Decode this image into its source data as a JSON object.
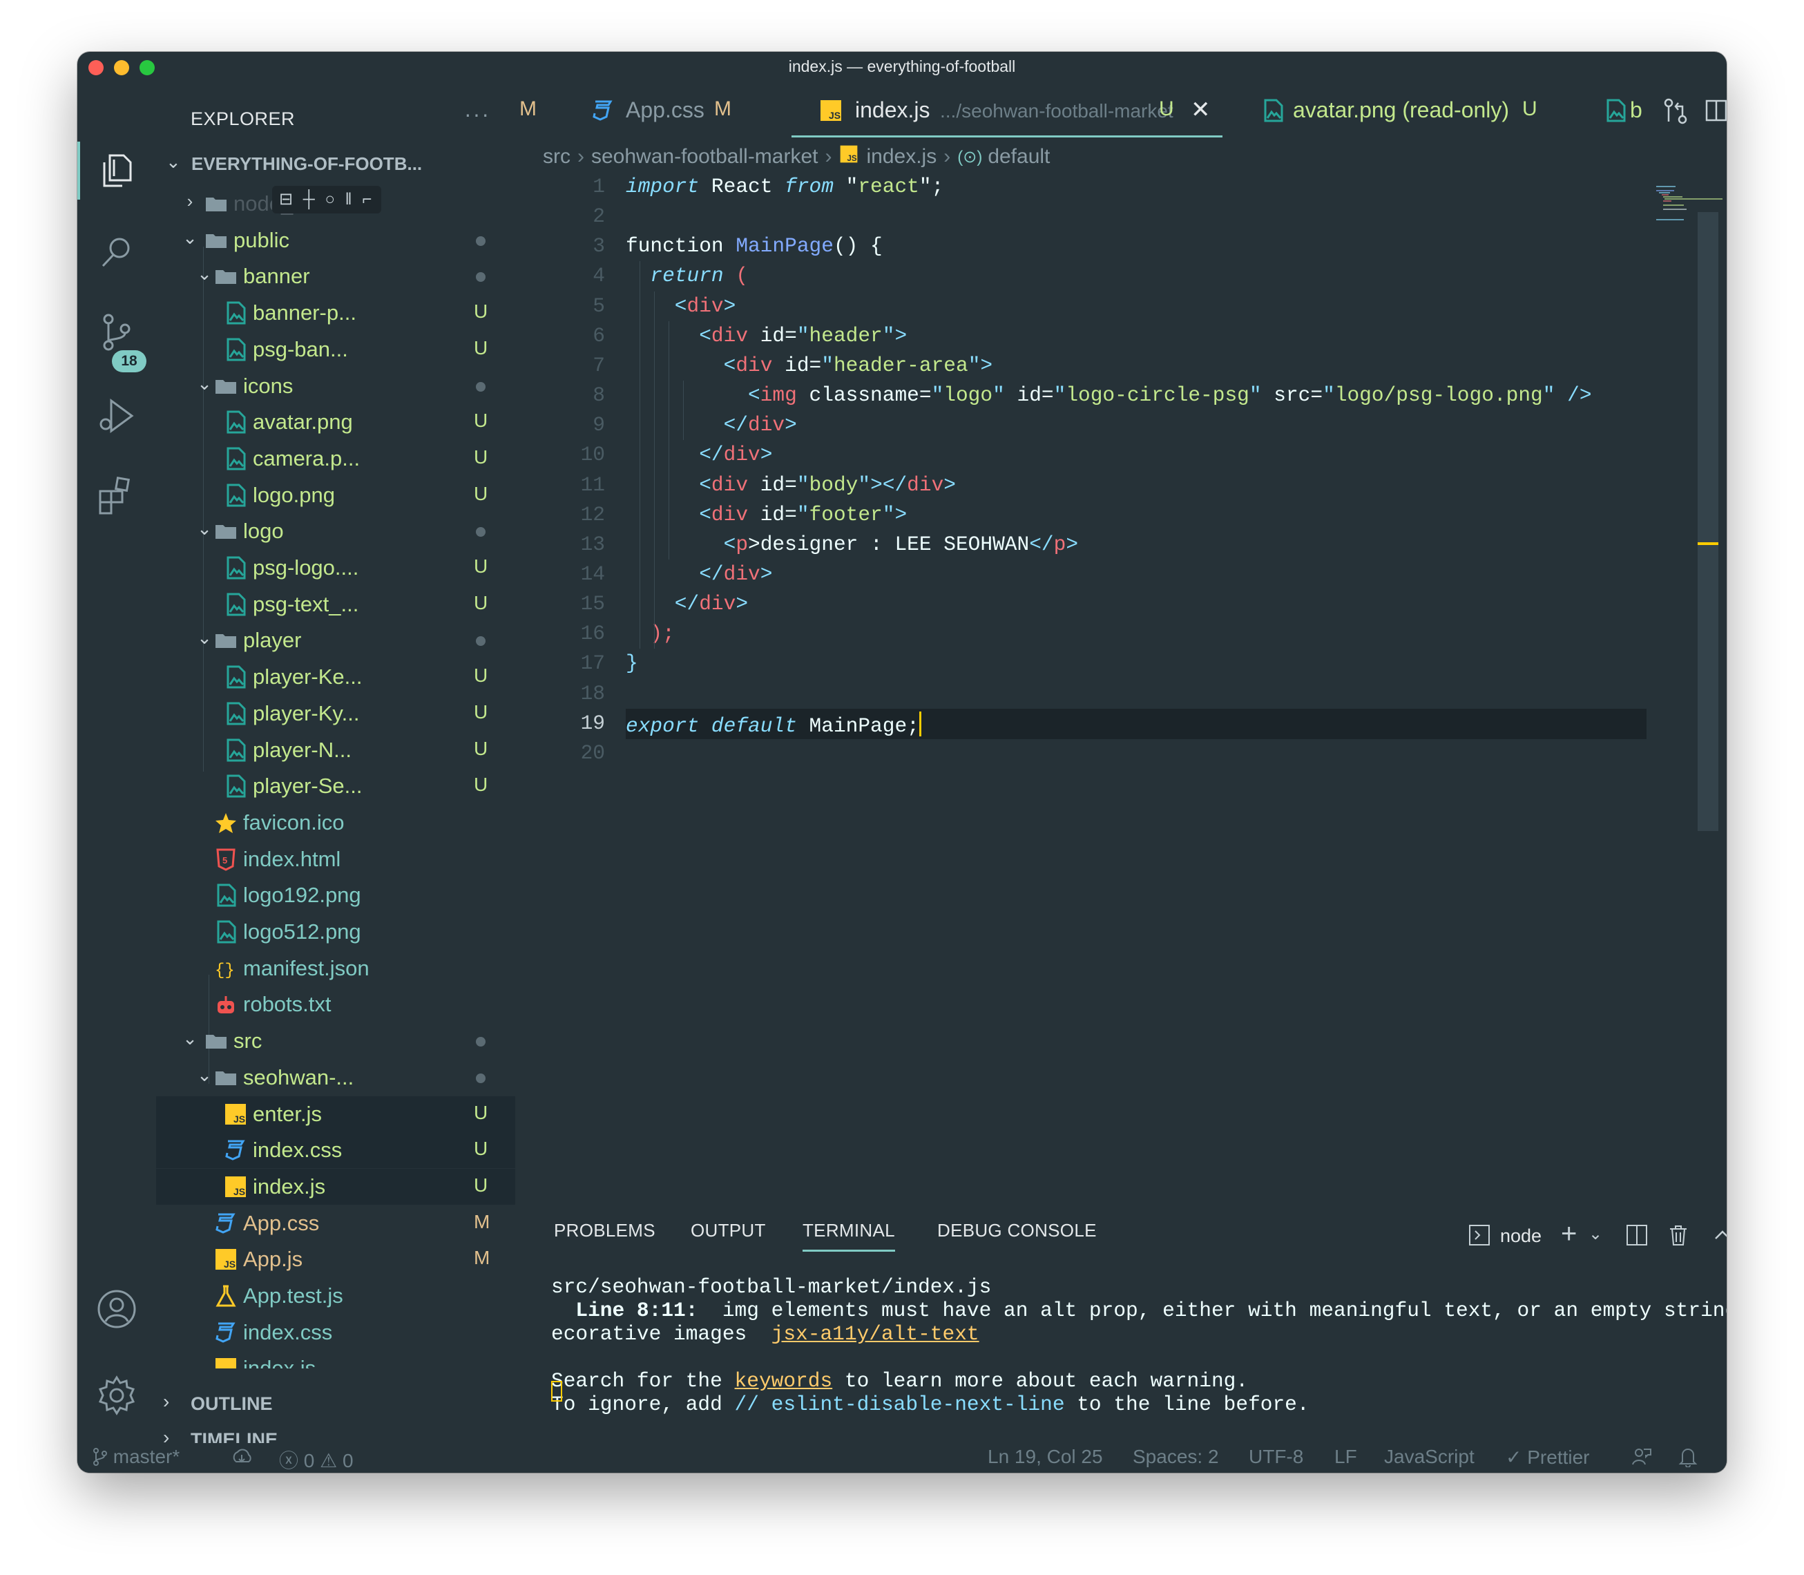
{
  "window": {
    "title": "index.js — everything-of-football"
  },
  "colors": {
    "bg": "#263238",
    "accent": "#80cbc4",
    "fg": "#eeffff",
    "folder": "#90a4ae",
    "git_untracked": "#c3e88d",
    "git_modified": "#e2c08d",
    "js_yellow": "#ffca28",
    "keyword_italic": "#89ddff",
    "string": "#c3e88d",
    "tag": "#f07178",
    "func": "#82aaff",
    "cursor": "#ffcc00"
  },
  "activity_bar": {
    "items": [
      {
        "name": "explorer-icon"
      },
      {
        "name": "search-icon"
      },
      {
        "name": "source-control-icon",
        "badge": "18"
      },
      {
        "name": "run-debug-icon"
      },
      {
        "name": "extensions-icon"
      }
    ],
    "bottom": [
      {
        "name": "account-icon"
      },
      {
        "name": "settings-gear-icon"
      }
    ]
  },
  "explorer": {
    "title": "EXPLORER",
    "more": "···",
    "root": "EVERYTHING-OF-FOOTB...",
    "rows": [
      {
        "label": "node_modules",
        "depth": 1,
        "kind": "folder-closed",
        "color": "#4f5b62",
        "status": "",
        "tooltip": "⊟ ┼ ○ ‖ ⌐"
      },
      {
        "label": "public",
        "depth": 1,
        "kind": "folder-open",
        "color": "#c3e88d",
        "status": "dot"
      },
      {
        "label": "banner",
        "depth": 2,
        "kind": "folder-open",
        "color": "#c3e88d",
        "status": "dot"
      },
      {
        "label": "banner-p...",
        "depth": 3,
        "kind": "image",
        "color": "#c3e88d",
        "status": "U"
      },
      {
        "label": "psg-ban...",
        "depth": 3,
        "kind": "image",
        "color": "#c3e88d",
        "status": "U"
      },
      {
        "label": "icons",
        "depth": 2,
        "kind": "folder-open",
        "color": "#c3e88d",
        "status": "dot"
      },
      {
        "label": "avatar.png",
        "depth": 3,
        "kind": "image",
        "color": "#c3e88d",
        "status": "U"
      },
      {
        "label": "camera.p...",
        "depth": 3,
        "kind": "image",
        "color": "#c3e88d",
        "status": "U"
      },
      {
        "label": "logo.png",
        "depth": 3,
        "kind": "image",
        "color": "#c3e88d",
        "status": "U"
      },
      {
        "label": "logo",
        "depth": 2,
        "kind": "folder-open",
        "color": "#c3e88d",
        "status": "dot"
      },
      {
        "label": "psg-logo....",
        "depth": 3,
        "kind": "image",
        "color": "#c3e88d",
        "status": "U"
      },
      {
        "label": "psg-text_...",
        "depth": 3,
        "kind": "image",
        "color": "#c3e88d",
        "status": "U"
      },
      {
        "label": "player",
        "depth": 2,
        "kind": "folder-open",
        "color": "#c3e88d",
        "status": "dot"
      },
      {
        "label": "player-Ke...",
        "depth": 3,
        "kind": "image",
        "color": "#c3e88d",
        "status": "U"
      },
      {
        "label": "player-Ky...",
        "depth": 3,
        "kind": "image",
        "color": "#c3e88d",
        "status": "U"
      },
      {
        "label": "player-N...",
        "depth": 3,
        "kind": "image",
        "color": "#c3e88d",
        "status": "U"
      },
      {
        "label": "player-Se...",
        "depth": 3,
        "kind": "image",
        "color": "#c3e88d",
        "status": "U"
      },
      {
        "label": "favicon.ico",
        "depth": 2,
        "kind": "star",
        "color": "#80cbc4",
        "status": ""
      },
      {
        "label": "index.html",
        "depth": 2,
        "kind": "html",
        "color": "#80cbc4",
        "status": ""
      },
      {
        "label": "logo192.png",
        "depth": 2,
        "kind": "image",
        "color": "#80cbc4",
        "status": ""
      },
      {
        "label": "logo512.png",
        "depth": 2,
        "kind": "image",
        "color": "#80cbc4",
        "status": ""
      },
      {
        "label": "manifest.json",
        "depth": 2,
        "kind": "json",
        "color": "#80cbc4",
        "status": ""
      },
      {
        "label": "robots.txt",
        "depth": 2,
        "kind": "robot",
        "color": "#80cbc4",
        "status": ""
      },
      {
        "label": "src",
        "depth": 1,
        "kind": "folder-open",
        "color": "#c3e88d",
        "status": "dot"
      },
      {
        "label": "seohwan-...",
        "depth": 2,
        "kind": "folder-open",
        "color": "#c3e88d",
        "status": "dot"
      },
      {
        "label": "enter.js",
        "depth": 3,
        "kind": "js",
        "color": "#c3e88d",
        "status": "U",
        "selected": true
      },
      {
        "label": "index.css",
        "depth": 3,
        "kind": "css",
        "color": "#c3e88d",
        "status": "U",
        "selected": true
      },
      {
        "label": "index.js",
        "depth": 3,
        "kind": "js",
        "color": "#c3e88d",
        "status": "U",
        "selected": true
      },
      {
        "label": "App.css",
        "depth": 2,
        "kind": "css",
        "color": "#e2c08d",
        "status": "M"
      },
      {
        "label": "App.js",
        "depth": 2,
        "kind": "js",
        "color": "#e2c08d",
        "status": "M"
      },
      {
        "label": "App.test.js",
        "depth": 2,
        "kind": "test",
        "color": "#80cbc4",
        "status": ""
      },
      {
        "label": "index.css",
        "depth": 2,
        "kind": "css",
        "color": "#80cbc4",
        "status": ""
      },
      {
        "label": "index.js",
        "depth": 2,
        "kind": "js",
        "color": "#80cbc4",
        "status": "",
        "clipped": true
      }
    ],
    "outline": "OUTLINE",
    "timeline": "TIMELINE"
  },
  "tabs": [
    {
      "label": "",
      "status": "M",
      "icon": "none"
    },
    {
      "label": "App.css",
      "status": "M",
      "icon": "css"
    },
    {
      "label": "index.js",
      "desc": ".../seohwan-football-market",
      "status": "U",
      "icon": "js",
      "active": true
    },
    {
      "label": "avatar.png (read-only)",
      "status": "U",
      "icon": "image"
    },
    {
      "label": "b",
      "status": "",
      "icon": "image"
    }
  ],
  "tab_actions": [
    "open-changes-icon",
    "split-editor-icon",
    "more-actions-icon"
  ],
  "breadcrumbs": {
    "parts": [
      "src",
      "seohwan-football-market",
      "index.js",
      "default"
    ]
  },
  "code": {
    "current_line": 19,
    "lines": [
      [
        [
          "import",
          "kw"
        ],
        [
          " React ",
          "fg"
        ],
        [
          "from",
          "kw"
        ],
        [
          " \"",
          "fg"
        ],
        [
          "react",
          "str"
        ],
        [
          "\";",
          "fg"
        ]
      ],
      [],
      [
        [
          "function ",
          "fg"
        ],
        [
          "MainPage",
          "fn"
        ],
        [
          "() {",
          "fg"
        ]
      ],
      [
        [
          "  ",
          "fg"
        ],
        [
          "return",
          "kw"
        ],
        [
          " (",
          "tag"
        ]
      ],
      [
        [
          "    <",
          "pun"
        ],
        [
          "div",
          "tag"
        ],
        [
          ">",
          "pun"
        ]
      ],
      [
        [
          "      <",
          "pun"
        ],
        [
          "div",
          "tag"
        ],
        [
          " id=",
          "fg"
        ],
        [
          "\"",
          "pun"
        ],
        [
          "header",
          "str"
        ],
        [
          "\"",
          "pun"
        ],
        [
          ">",
          "pun"
        ]
      ],
      [
        [
          "        <",
          "pun"
        ],
        [
          "div",
          "tag"
        ],
        [
          " id=",
          "fg"
        ],
        [
          "\"",
          "pun"
        ],
        [
          "header-area",
          "str"
        ],
        [
          "\"",
          "pun"
        ],
        [
          ">",
          "pun"
        ]
      ],
      [
        [
          "          <",
          "pun"
        ],
        [
          "img",
          "tag"
        ],
        [
          " classname=",
          "fg"
        ],
        [
          "\"",
          "pun"
        ],
        [
          "logo",
          "str"
        ],
        [
          "\"",
          "pun"
        ],
        [
          " id=",
          "fg"
        ],
        [
          "\"",
          "pun"
        ],
        [
          "logo-circle-psg",
          "str"
        ],
        [
          "\"",
          "pun"
        ],
        [
          " src=",
          "fg"
        ],
        [
          "\"",
          "pun"
        ],
        [
          "logo/psg-logo.png",
          "str"
        ],
        [
          "\"",
          "pun"
        ],
        [
          " />",
          "pun"
        ]
      ],
      [
        [
          "        </",
          "pun"
        ],
        [
          "div",
          "tag"
        ],
        [
          ">",
          "pun"
        ]
      ],
      [
        [
          "      </",
          "pun"
        ],
        [
          "div",
          "tag"
        ],
        [
          ">",
          "pun"
        ]
      ],
      [
        [
          "      <",
          "pun"
        ],
        [
          "div",
          "tag"
        ],
        [
          " id=",
          "fg"
        ],
        [
          "\"",
          "pun"
        ],
        [
          "body",
          "str"
        ],
        [
          "\"",
          "pun"
        ],
        [
          "></",
          "pun"
        ],
        [
          "div",
          "tag"
        ],
        [
          ">",
          "pun"
        ]
      ],
      [
        [
          "      <",
          "pun"
        ],
        [
          "div",
          "tag"
        ],
        [
          " id=",
          "fg"
        ],
        [
          "\"",
          "pun"
        ],
        [
          "footer",
          "str"
        ],
        [
          "\"",
          "pun"
        ],
        [
          ">",
          "pun"
        ]
      ],
      [
        [
          "        <",
          "pun"
        ],
        [
          "p",
          "tag"
        ],
        [
          ">designer : LEE SEOHWAN",
          "fg"
        ],
        [
          "</",
          "pun"
        ],
        [
          "p",
          "tag"
        ],
        [
          ">",
          "pun"
        ]
      ],
      [
        [
          "      </",
          "pun"
        ],
        [
          "div",
          "tag"
        ],
        [
          ">",
          "pun"
        ]
      ],
      [
        [
          "    </",
          "pun"
        ],
        [
          "div",
          "tag"
        ],
        [
          ">",
          "pun"
        ]
      ],
      [
        [
          "  ",
          "fg"
        ],
        [
          ");",
          "tag"
        ]
      ],
      [
        [
          "}",
          "pun"
        ]
      ],
      [],
      [
        [
          "export",
          "kw"
        ],
        [
          " ",
          "fg"
        ],
        [
          "default",
          "kw"
        ],
        [
          " MainPage;",
          "fg"
        ]
      ],
      []
    ]
  },
  "panel": {
    "tabs": [
      "PROBLEMS",
      "OUTPUT",
      "TERMINAL",
      "DEBUG CONSOLE"
    ],
    "active": "TERMINAL",
    "terminal_name": "node",
    "terminal": {
      "file": "src/seohwan-football-market/index.js",
      "line_ref": "  Line 8:11:",
      "msg1": "  img elements must have an alt prop, either with meaningful text, or an empty string for d",
      "msg2": "ecorative images  ",
      "rule": "jsx-a11y/alt-text",
      "s1": "Search for the ",
      "kw": "keywords",
      "s2": " to learn more about each warning.",
      "i1": "To ignore, add ",
      "disable": "// eslint-disable-next-line",
      "i2": " to the line before."
    }
  },
  "statusbar": {
    "branch": "master*",
    "errors": "0",
    "warnings": "0",
    "position": "Ln 19, Col 25",
    "spaces": "Spaces: 2",
    "encoding": "UTF-8",
    "eol": "LF",
    "language": "JavaScript",
    "formatter": "Prettier"
  }
}
